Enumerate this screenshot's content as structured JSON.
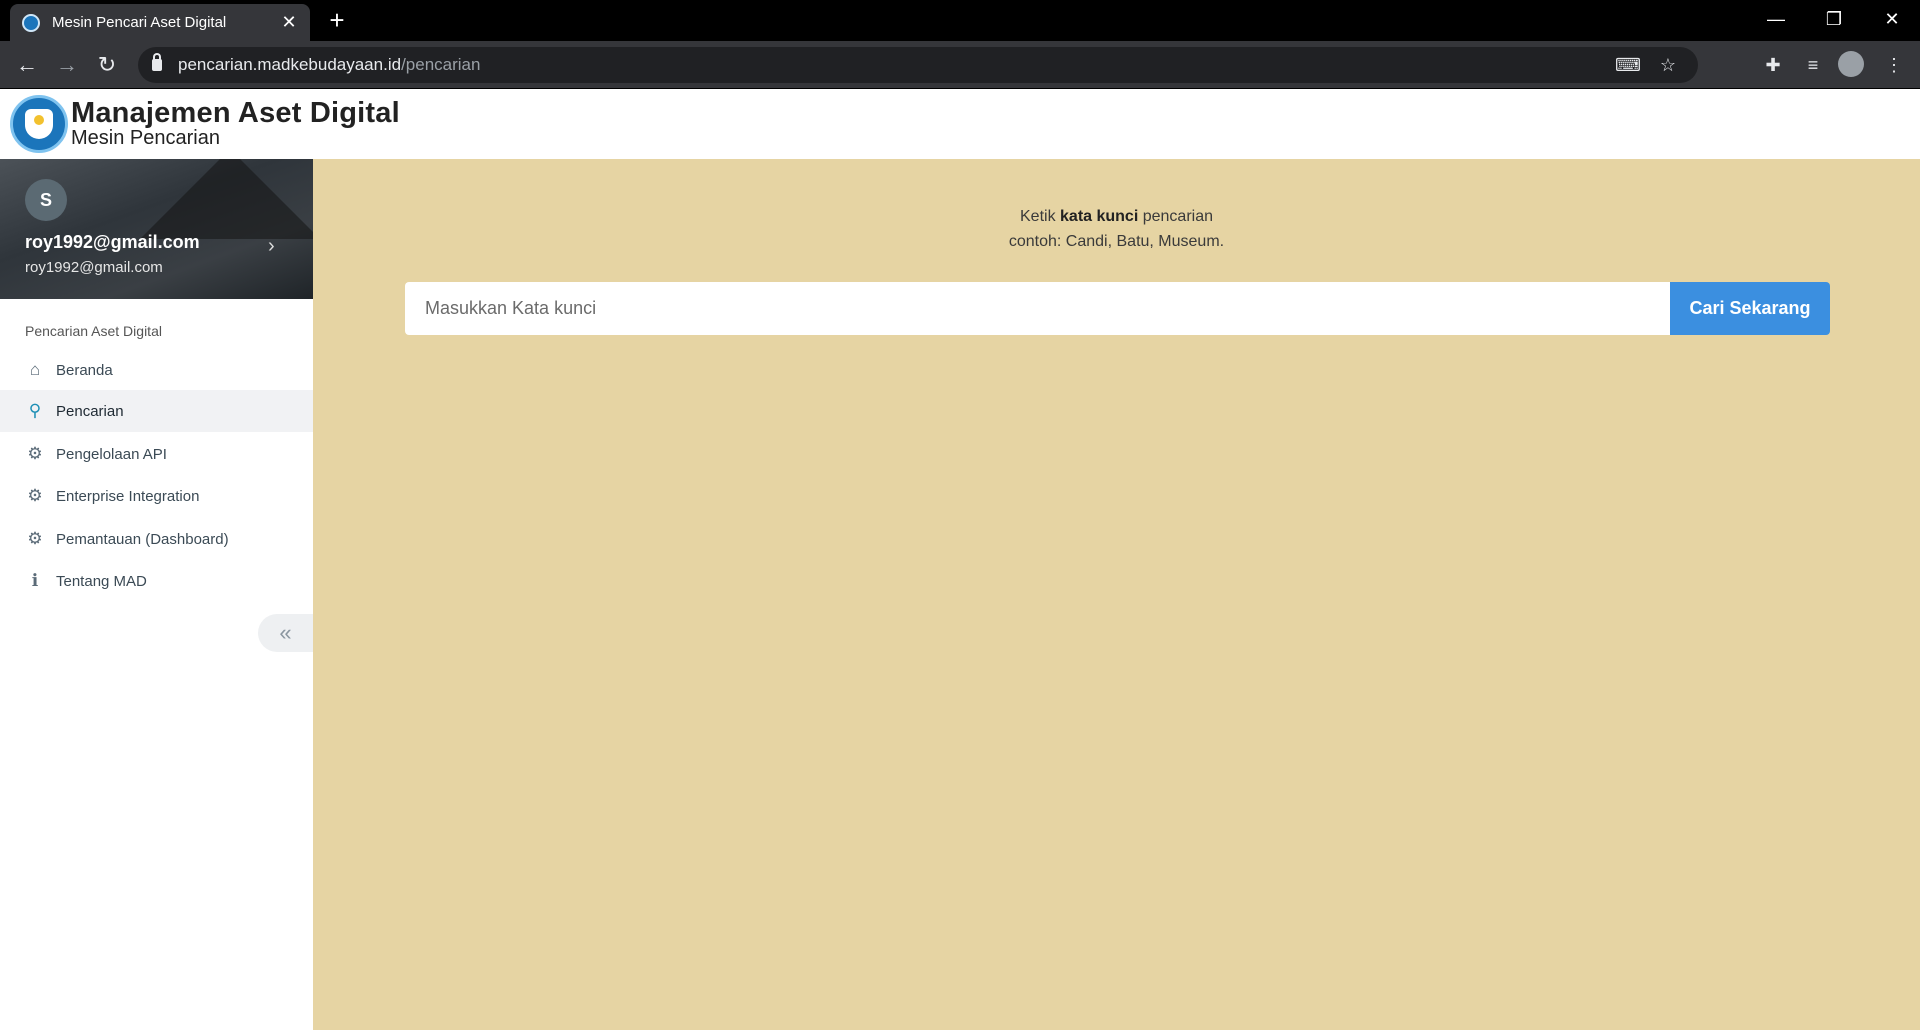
{
  "browser": {
    "tab_title": "Mesin Pencari Aset Digital",
    "tab_close": "✕",
    "new_tab": "+",
    "url_host": "pencarian.madkebudayaan.id",
    "url_path": "/pencarian",
    "window_controls": {
      "minimize": "—",
      "restore": "❐",
      "close": "✕"
    },
    "nav": {
      "back": "←",
      "forward": "→",
      "reload": "↻"
    },
    "icons": {
      "translate": "⌨",
      "star": "☆",
      "extensions": "✚",
      "media": "≡",
      "menu": "⋮"
    }
  },
  "header": {
    "title": "Manajemen Aset Digital",
    "subtitle": "Mesin Pencarian"
  },
  "profile": {
    "avatar_letter": "S",
    "name": "roy1992@gmail.com",
    "email": "roy1992@gmail.com",
    "chevron": "›"
  },
  "sidebar": {
    "section_title": "Pencarian Aset Digital",
    "items": [
      {
        "label": "Beranda",
        "icon": "⌂"
      },
      {
        "label": "Pencarian",
        "icon": "⚲"
      },
      {
        "label": "Pengelolaan API",
        "icon": "⚙"
      },
      {
        "label": "Enterprise Integration",
        "icon": "⚙"
      },
      {
        "label": "Pemantauan (Dashboard)",
        "icon": "⚙"
      },
      {
        "label": "Tentang MAD",
        "icon": "ℹ"
      }
    ],
    "collapse": "«"
  },
  "main": {
    "hint_prefix": "Ketik ",
    "hint_bold": "kata kunci",
    "hint_suffix": " pencarian",
    "hint_example": "contoh: Candi, Batu, Museum.",
    "search_placeholder": "Masukkan Kata kunci",
    "search_button": "Cari Sekarang"
  }
}
